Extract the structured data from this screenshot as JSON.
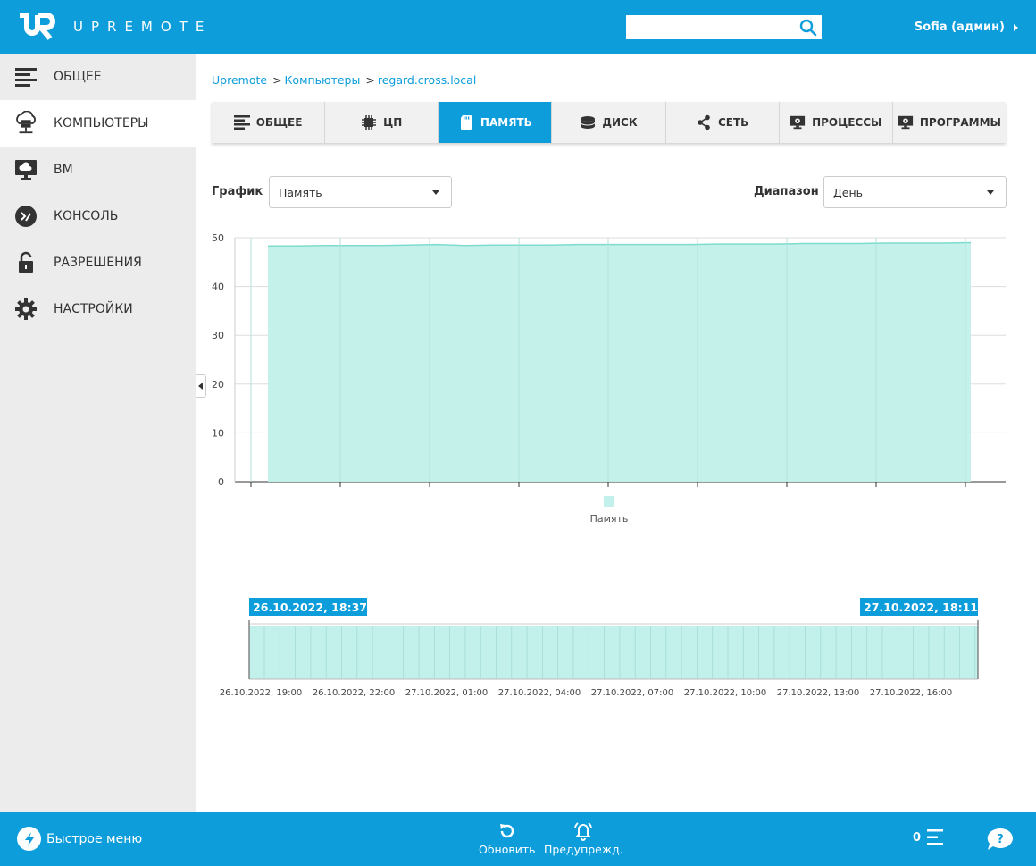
{
  "header": {
    "logo_text": "UPREMOTE",
    "search_placeholder": "",
    "user": "Sofia (админ)"
  },
  "sidebar": {
    "items": [
      {
        "label": "ОБЩЕЕ",
        "icon": "list-icon"
      },
      {
        "label": "КОМПЬЮТЕРЫ",
        "icon": "cloud-server-icon"
      },
      {
        "label": "ВМ",
        "icon": "monitor-cloud-icon"
      },
      {
        "label": "КОНСОЛЬ",
        "icon": "terminal-icon"
      },
      {
        "label": "РАЗРЕШЕНИЯ",
        "icon": "lock-icon"
      },
      {
        "label": "НАСТРОЙКИ",
        "icon": "gear-icon"
      }
    ]
  },
  "breadcrumb": {
    "items": [
      "Upremote",
      "Компьютеры",
      "regard.cross.local"
    ]
  },
  "tabs": [
    {
      "label": "ОБЩЕЕ",
      "icon": "list-icon"
    },
    {
      "label": "ЦП",
      "icon": "chip-icon"
    },
    {
      "label": "ПАМЯТЬ",
      "icon": "memory-card-icon"
    },
    {
      "label": "ДИСК",
      "icon": "disk-icon"
    },
    {
      "label": "СЕТЬ",
      "icon": "share-icon"
    },
    {
      "label": "ПРОЦЕССЫ",
      "icon": "monitor-gear-icon"
    },
    {
      "label": "ПРОГРАММЫ",
      "icon": "monitor-gear-icon"
    }
  ],
  "controls": {
    "graph_label": "График",
    "graph_value": "Память",
    "range_label": "Диапазон",
    "range_value": "День"
  },
  "colors": {
    "accent": "#0d9ddb",
    "area_fill": "#c2f0ea",
    "area_line": "#7ddccd"
  },
  "chart_data": {
    "type": "area",
    "title": "",
    "xlabel": "",
    "ylabel": "",
    "ylim": [
      0,
      50
    ],
    "yticks": [
      0,
      10,
      20,
      30,
      40,
      50
    ],
    "grid": true,
    "legend": "bottom",
    "series": [
      {
        "name": "Память",
        "values": [
          48.3,
          48.3,
          48.4,
          48.4,
          48.4,
          48.5,
          48.6,
          48.4,
          48.5,
          48.5,
          48.5,
          48.6,
          48.6,
          48.6,
          48.6,
          48.6,
          48.7,
          48.7,
          48.7,
          48.8,
          48.8,
          48.8,
          48.9,
          48.9,
          48.9,
          49.0
        ]
      }
    ]
  },
  "navigator": {
    "start_label": "26.10.2022, 18:37",
    "end_label": "27.10.2022, 18:11",
    "ticks": [
      "26.10.2022, 19:00",
      "26.10.2022, 22:00",
      "27.10.2022, 01:00",
      "27.10.2022, 04:00",
      "27.10.2022, 07:00",
      "27.10.2022, 10:00",
      "27.10.2022, 13:00",
      "27.10.2022, 16:00"
    ]
  },
  "footer": {
    "quick_menu": "Быстрое меню",
    "refresh": "Обновить",
    "alerts": "Предупрежд.",
    "count": "0"
  }
}
